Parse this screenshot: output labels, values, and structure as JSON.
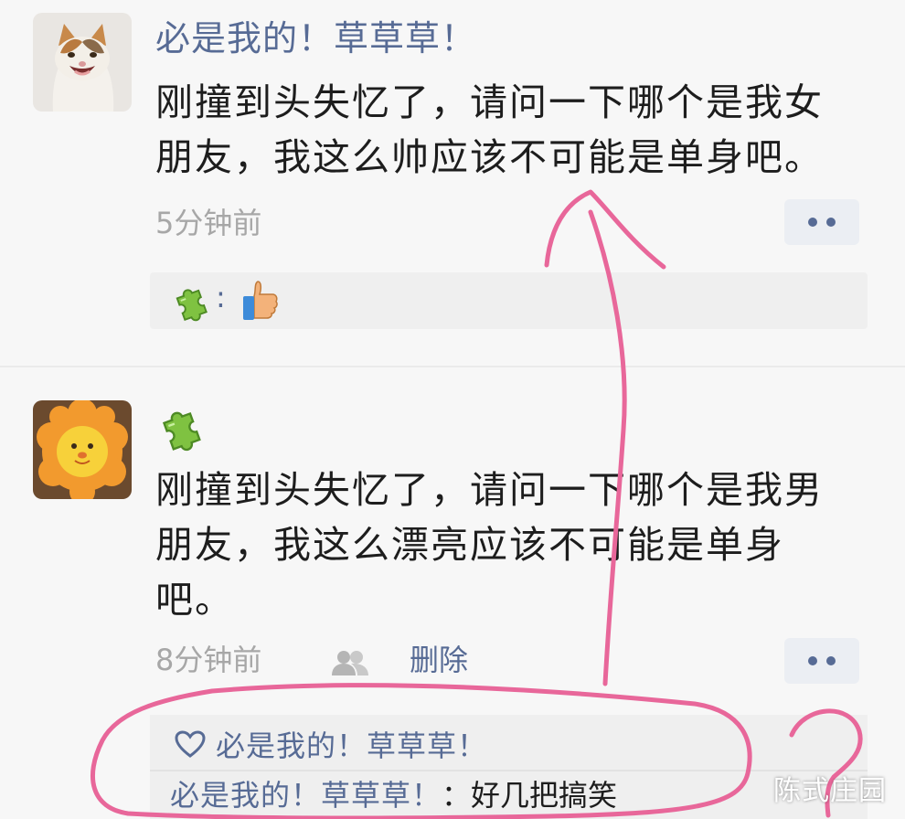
{
  "post1": {
    "nickname": "必是我的！草草草！",
    "content": "刚撞到头失忆了，请问一下哪个是我女朋友，我这么帅应该不可能是单身吧。",
    "time": "5分钟前",
    "likes_colon": ":",
    "avatar_icon": "cat-avatar",
    "like_user_icon": "puzzle-piece-icon",
    "like_reaction_icon": "thumbs-up-icon"
  },
  "post2": {
    "content": "刚撞到头失忆了，请问一下哪个是我男朋友，我这么漂亮应该不可能是单身吧。",
    "time": "8分钟前",
    "delete_label": "删除",
    "avatar_icon": "lion-plush-avatar",
    "nickname_icon": "puzzle-piece-icon",
    "liked_by": "必是我的！草草草！",
    "comment": {
      "author": "必是我的！草草草！",
      "separator": "：",
      "text": "好几把搞笑"
    }
  },
  "watermark": "陈式庄园",
  "colors": {
    "link": "#576b95",
    "meta": "#a7a7a7",
    "annotation": "#e8679a",
    "background": "#f7f7f7"
  }
}
